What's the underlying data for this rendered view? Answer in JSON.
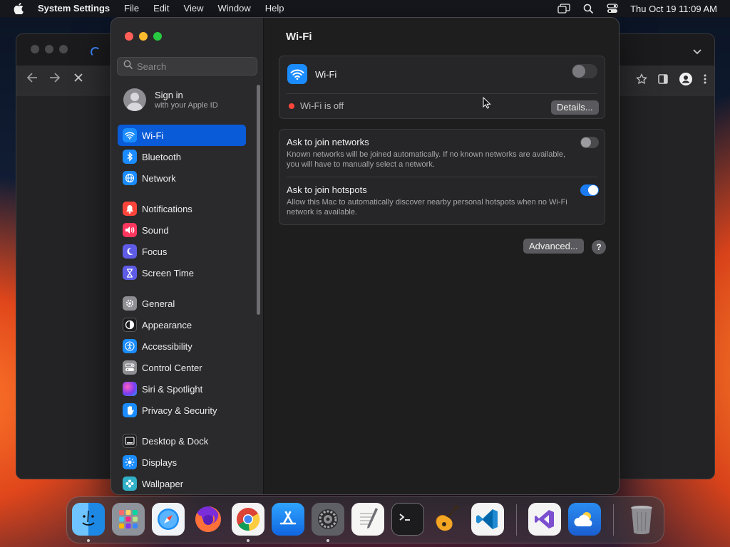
{
  "menubar": {
    "apple_icon": "apple-logo-icon",
    "app_name": "System Settings",
    "items": [
      "File",
      "Edit",
      "View",
      "Window",
      "Help"
    ],
    "status_icons": [
      "screen-mirroring-icon",
      "spotlight-search-icon",
      "control-center-icon"
    ],
    "clock": "Thu Oct 19  11:09 AM"
  },
  "sidebar": {
    "search_placeholder": "Search",
    "account": {
      "title": "Sign in",
      "subtitle": "with your Apple ID"
    },
    "items": [
      {
        "label": "Wi-Fi",
        "icon": "wifi-icon",
        "color": "#1a8cff",
        "active": true
      },
      {
        "label": "Bluetooth",
        "icon": "bluetooth-icon",
        "color": "#1a8cff"
      },
      {
        "label": "Network",
        "icon": "globe-icon",
        "color": "#1a8cff"
      },
      {
        "label": "Notifications",
        "icon": "bell-icon",
        "color": "#ff453a"
      },
      {
        "label": "Sound",
        "icon": "speaker-icon",
        "color": "#ff375f"
      },
      {
        "label": "Focus",
        "icon": "moon-icon",
        "color": "#5e5ce6"
      },
      {
        "label": "Screen Time",
        "icon": "hourglass-icon",
        "color": "#5e5ce6"
      },
      {
        "label": "General",
        "icon": "gear-icon",
        "color": "#8e8e93"
      },
      {
        "label": "Appearance",
        "icon": "appearance-icon",
        "color": "#1c1c1e"
      },
      {
        "label": "Accessibility",
        "icon": "accessibility-icon",
        "color": "#1a8cff"
      },
      {
        "label": "Control Center",
        "icon": "control-center-icon",
        "color": "#8e8e93"
      },
      {
        "label": "Siri & Spotlight",
        "icon": "siri-icon",
        "color": "#bf5af2"
      },
      {
        "label": "Privacy & Security",
        "icon": "hand-icon",
        "color": "#1a8cff"
      },
      {
        "label": "Desktop & Dock",
        "icon": "dock-icon",
        "color": "#1c1c1e"
      },
      {
        "label": "Displays",
        "icon": "sun-icon",
        "color": "#1a8cff"
      },
      {
        "label": "Wallpaper",
        "icon": "flower-icon",
        "color": "#30b0c7"
      }
    ]
  },
  "main": {
    "title": "Wi-Fi",
    "wifi": {
      "label": "Wi-Fi",
      "enabled": false,
      "status": "Wi-Fi is off",
      "status_color": "#ff453a",
      "details_button": "Details..."
    },
    "preferences": [
      {
        "title": "Ask to join networks",
        "description": "Known networks will be joined automatically. If no known networks are available, you will have to manually select a network.",
        "enabled": false
      },
      {
        "title": "Ask to join hotspots",
        "description": "Allow this Mac to automatically discover nearby personal hotspots when no Wi-Fi network is available.",
        "enabled": true
      }
    ],
    "advanced_button": "Advanced...",
    "help_button": "?"
  },
  "dock": {
    "apps": [
      {
        "name": "finder-app-icon",
        "color": "#1e88e5",
        "running": true
      },
      {
        "name": "launchpad-app-icon",
        "color": "#9aa0a6",
        "running": false
      },
      {
        "name": "safari-app-icon",
        "color": "#e8eef5",
        "running": false
      },
      {
        "name": "firefox-app-icon",
        "color": "#ff7139",
        "running": false
      },
      {
        "name": "chrome-app-icon",
        "color": "#ffffff",
        "running": true
      },
      {
        "name": "app-store-app-icon",
        "color": "#1a8cff",
        "running": false
      },
      {
        "name": "system-settings-app-icon",
        "color": "#6e6e73",
        "running": true
      },
      {
        "name": "textedit-app-icon",
        "color": "#f2f2f2",
        "running": false
      },
      {
        "name": "terminal-app-icon",
        "color": "#1c1c1e",
        "running": false
      },
      {
        "name": "garageband-app-icon",
        "color": "#f5a623",
        "running": false
      },
      {
        "name": "vscode-app-icon",
        "color": "#ffffff",
        "running": false
      },
      {
        "name": "visual-studio-app-icon",
        "color": "#ffffff",
        "running": false
      },
      {
        "name": "weather-app-icon",
        "color": "#2a8cf0",
        "running": false
      },
      {
        "name": "trash-app-icon",
        "color": "#8e8e93",
        "running": false
      }
    ]
  }
}
